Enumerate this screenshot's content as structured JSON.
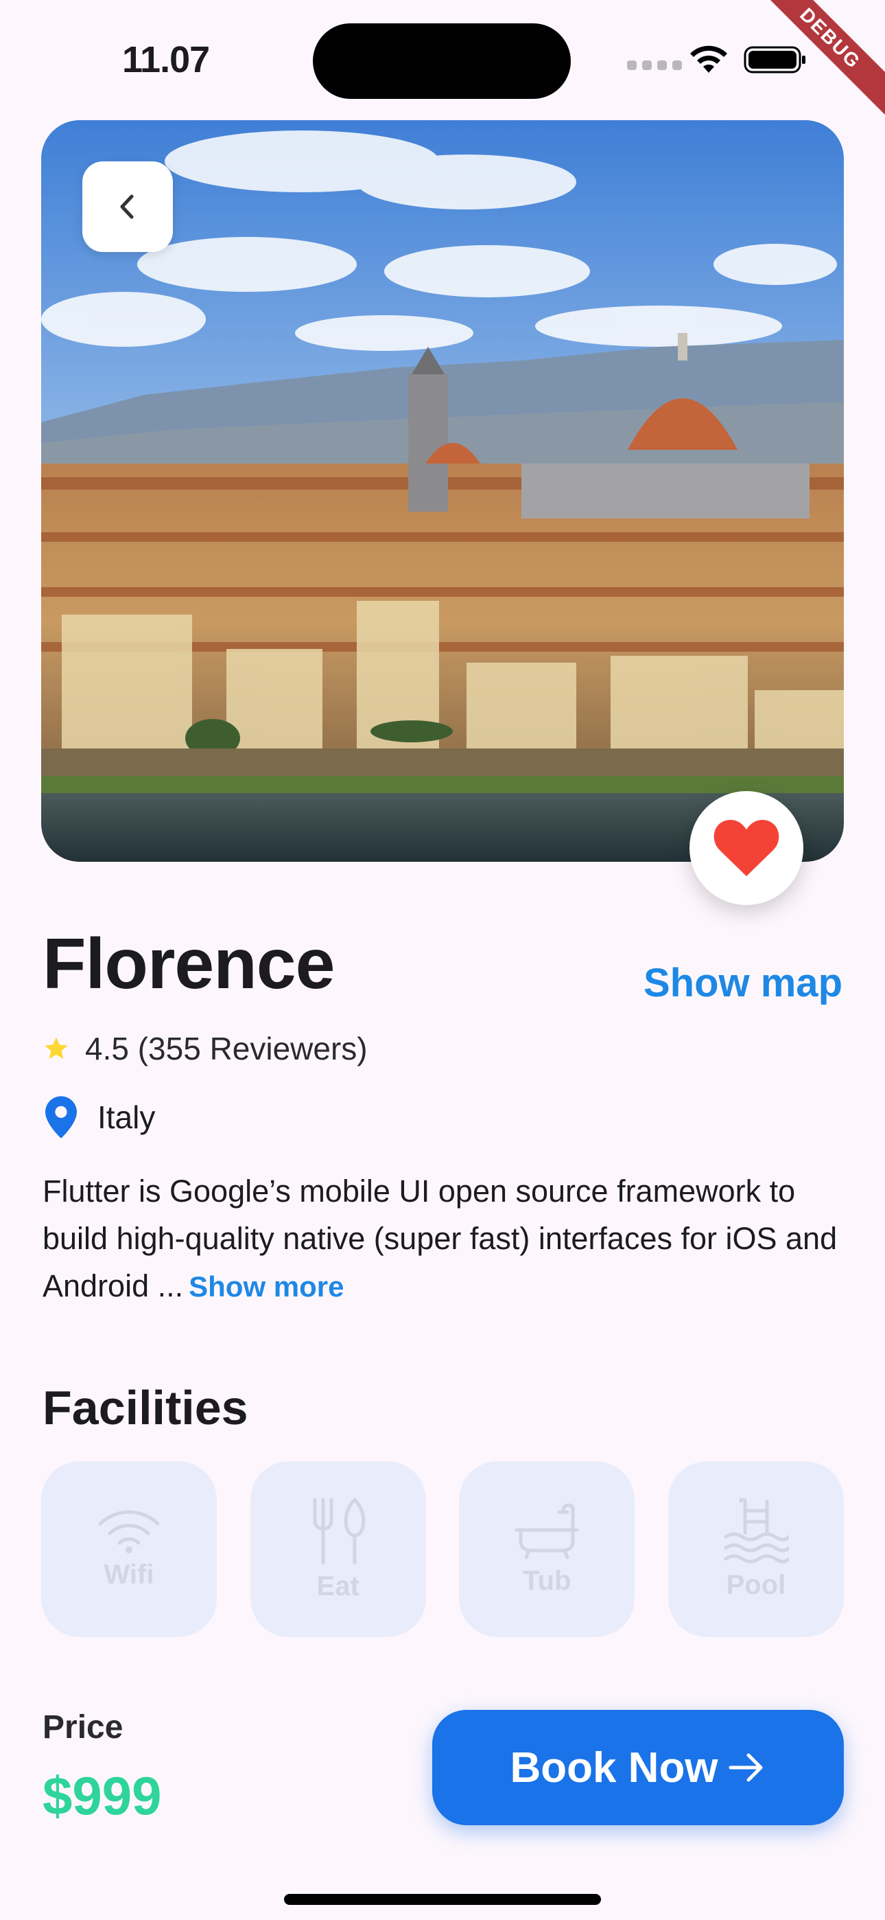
{
  "status_bar": {
    "time": "11.07",
    "debug_label": "DEBUG"
  },
  "hero": {
    "image_description_icon": "city-photo",
    "back_icon": "chevron-left-icon",
    "favorite_icon": "heart-icon",
    "favorite_color": "#f44336"
  },
  "place": {
    "name": "Florence",
    "show_map_label": "Show map",
    "rating": "4.5 (355 Reviewers)",
    "location": "Italy",
    "description": "Flutter is Google’s mobile UI open source framework to build high-quality native (super fast) interfaces for iOS and Android ...",
    "show_more_label": "Show more"
  },
  "facilities": {
    "title": "Facilities",
    "items": [
      {
        "label": "Wifi",
        "icon": "wifi-icon"
      },
      {
        "label": "Eat",
        "icon": "utensils-icon"
      },
      {
        "label": "Tub",
        "icon": "bathtub-icon"
      },
      {
        "label": "Pool",
        "icon": "pool-icon"
      }
    ]
  },
  "footer": {
    "price_label": "Price",
    "price_value": "$999",
    "book_label": "Book Now"
  },
  "colors": {
    "accent": "#1a73e8",
    "link": "#1e88e5",
    "price": "#2ed49a",
    "star": "#fdd835",
    "pin": "#1a73e8"
  }
}
